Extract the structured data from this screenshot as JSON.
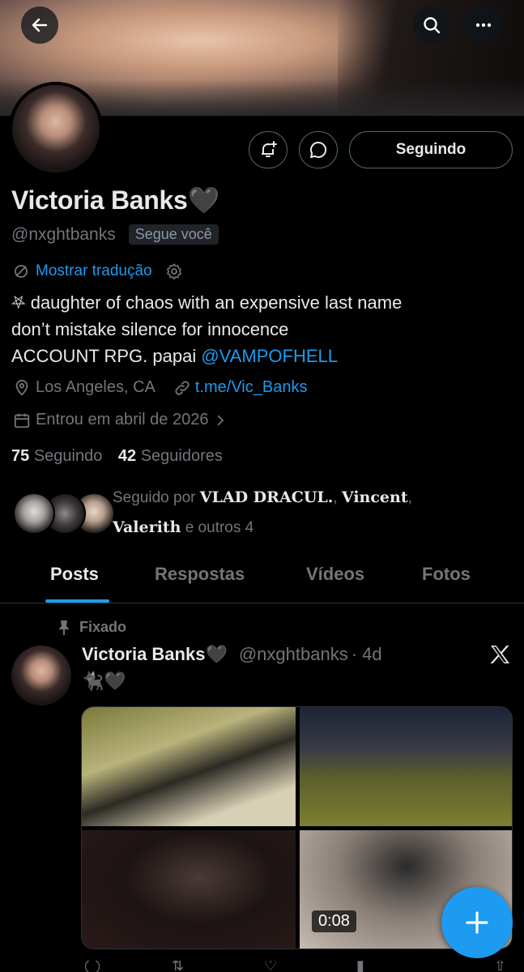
{
  "header": {
    "back_icon": "arrow-left-icon",
    "search_icon": "search-icon",
    "more_icon": "more-horizontal-icon"
  },
  "profile": {
    "name": "Victoria Banks🖤",
    "handle": "@nxghtbanks",
    "follows_you_badge": "Segue você",
    "translate_label": "Mostrar tradução",
    "bio_line1": "⛧ daughter of chaos with an expensive last name",
    "bio_line2": "don’t mistake silence for innocence",
    "bio_line3_prefix": "ACCOUNT RPG. papai ",
    "bio_line3_mention": "@VAMPOFHELL",
    "location": "Los Angeles, CA",
    "website": "t.me/Vic_Banks",
    "joined": "Entrou em abril de 2026",
    "following_count": "75",
    "following_label": "Seguindo",
    "followers_count": "42",
    "followers_label": "Seguidores",
    "followed_by_prefix": "Seguido por ",
    "followed_by_name1": "VLAD DRACUL.",
    "followed_by_sep1": ", ",
    "followed_by_name2": "Vincent",
    "followed_by_sep2": ",",
    "followed_by_name3": "Valerith",
    "followed_by_suffix": " e outros 4"
  },
  "actions": {
    "notify_icon": "bell-plus-icon",
    "message_icon": "chat-bubble-icon",
    "following_button": "Seguindo"
  },
  "tabs": [
    {
      "label": "Posts",
      "active": true
    },
    {
      "label": "Respostas",
      "active": false
    },
    {
      "label": "Vídeos",
      "active": false
    },
    {
      "label": "Fotos",
      "active": false
    }
  ],
  "pinned_post": {
    "pinned_label": "Fixado",
    "author_name": "Victoria Banks🖤",
    "author_handle": "@nxghtbanks",
    "time": "· 4d",
    "text": "🐈‍⬛🖤",
    "video_duration": "0:08",
    "source_icon": "x-logo-icon"
  },
  "fab": {
    "icon": "plus-icon"
  },
  "colors": {
    "accent": "#1d9bf0",
    "background": "#000000",
    "muted": "#71767b",
    "text": "#e7e9ea"
  }
}
